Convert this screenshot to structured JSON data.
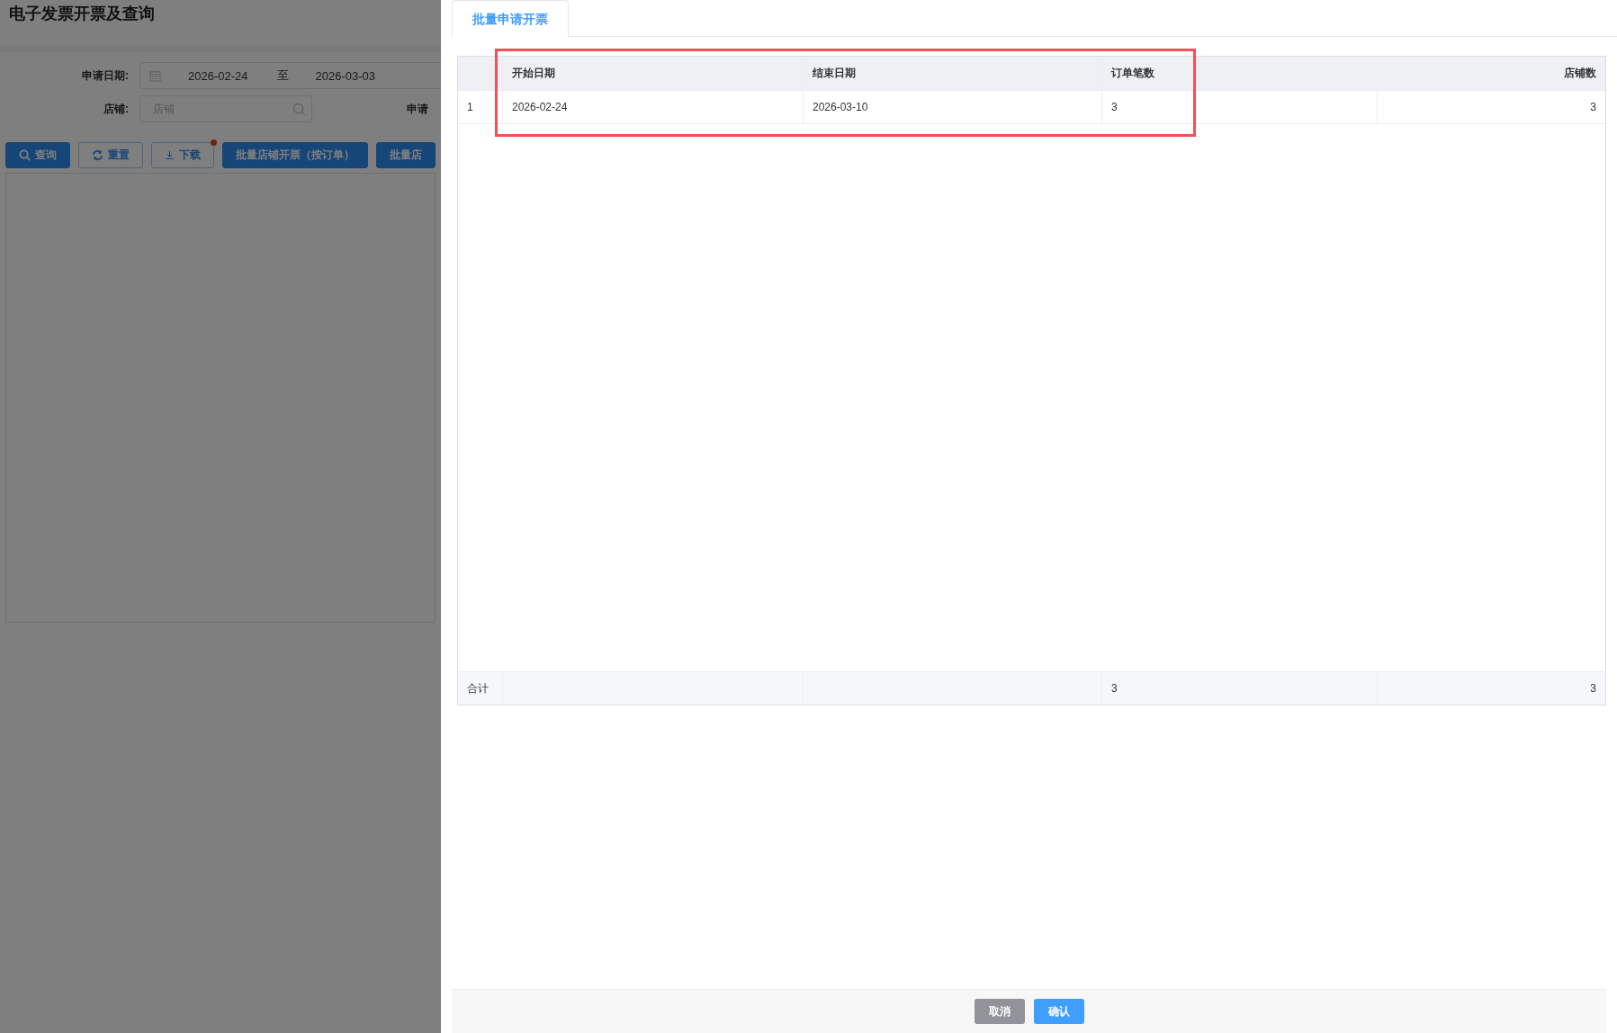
{
  "background_page": {
    "title": "电子发票开票及查询",
    "filters": [
      {
        "kind": "date_range",
        "label": "申请日期:",
        "start": "2026-02-24",
        "separator": "至",
        "end": "2026-03-03"
      },
      {
        "kind": "search",
        "label": "店铺:",
        "placeholder": "店铺"
      }
    ],
    "cut_label": "申请",
    "buttons": [
      {
        "kind": "search",
        "label": "查询",
        "dot": false
      },
      {
        "kind": "reset",
        "label": "重置",
        "dot": false
      },
      {
        "kind": "download",
        "label": "下载",
        "dot": true
      },
      {
        "kind": "primary",
        "label": "批量店铺开票（按订单）",
        "dot": false
      },
      {
        "kind": "primary",
        "label": "批量店",
        "dot": false
      }
    ]
  },
  "dialog": {
    "tabs": [
      {
        "label": "批量申请开票",
        "selected": true
      }
    ],
    "table": {
      "columns": [
        "开始日期",
        "结束日期",
        "订单笔数",
        "店铺数"
      ],
      "rows": [
        {
          "index": "1",
          "cells": [
            "2026-02-24",
            "2026-03-10",
            "3",
            "3"
          ]
        }
      ],
      "summary": {
        "label": "合计",
        "cells": [
          null,
          null,
          "3",
          "3"
        ]
      }
    },
    "buttons": [
      {
        "kind": "secondary",
        "label": "取消"
      },
      {
        "kind": "primary",
        "label": "确认"
      }
    ]
  }
}
